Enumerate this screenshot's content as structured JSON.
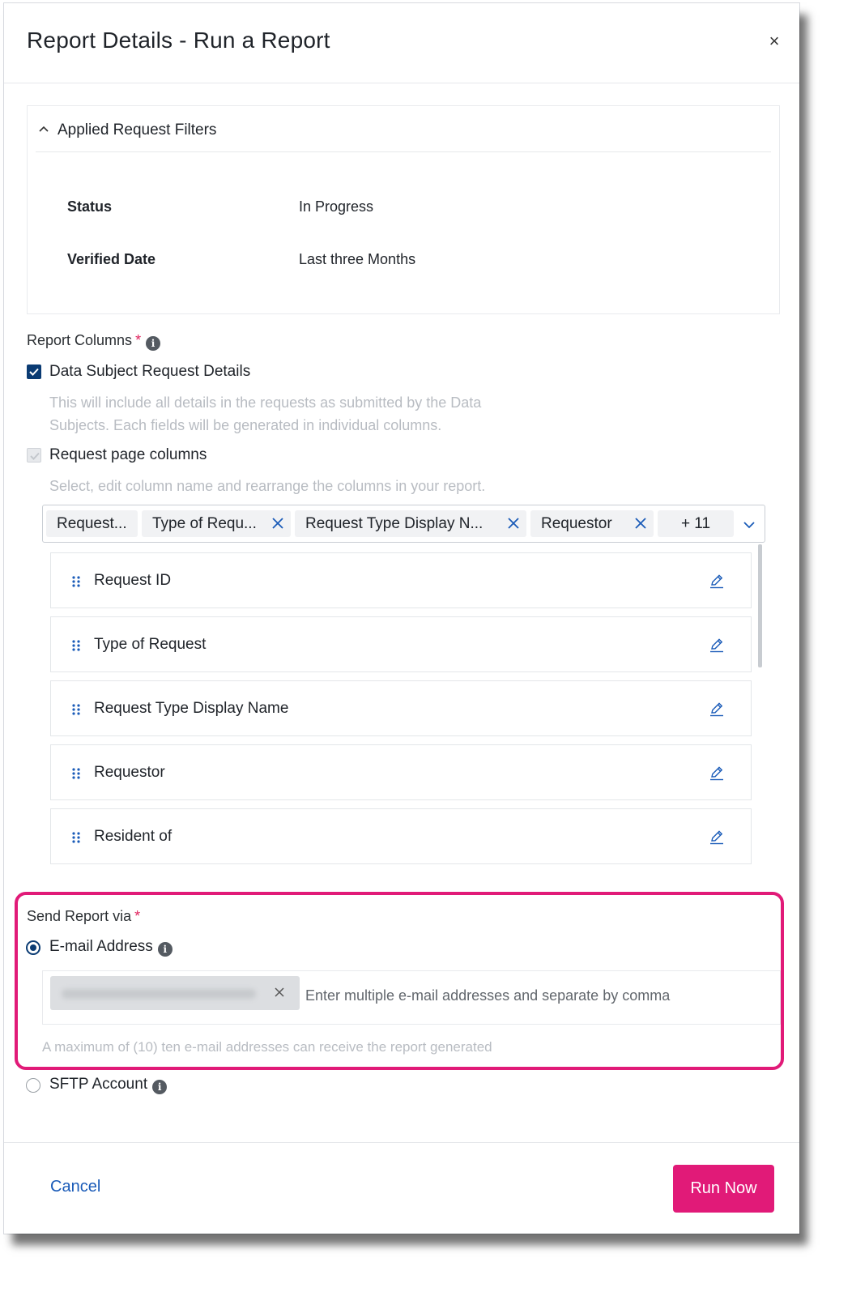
{
  "modal": {
    "title": "Report Details - Run a Report",
    "close_label": "×"
  },
  "filters": {
    "title": "Applied Request Filters",
    "rows": [
      {
        "label": "Status",
        "value": "In Progress"
      },
      {
        "label": "Verified Date",
        "value": "Last three Months"
      }
    ]
  },
  "report_columns": {
    "label": "Report Columns",
    "required_mark": "*",
    "info": "i",
    "dsr_details": {
      "label": "Data Subject Request Details",
      "checked": true,
      "helper_line1": "This will include all details in the requests as submitted by the Data",
      "helper_line2": "Subjects. Each fields will be generated in individual columns."
    },
    "page_columns": {
      "label": "Request page columns",
      "checked": true,
      "disabled": true,
      "helper": "Select, edit column name and rearrange the columns in your report."
    },
    "chips": [
      "Request...",
      "Type of Requ...",
      "Request Type Display N...",
      "Requestor"
    ],
    "more_chip": "+ 11",
    "columns": [
      "Request ID",
      "Type of Request",
      "Request Type Display Name",
      "Requestor",
      "Resident of"
    ]
  },
  "send_via": {
    "label": "Send Report via",
    "required_mark": "*",
    "email_option": "E-mail Address",
    "email_placeholder": "Enter multiple e-mail addresses and separate by comma",
    "email_hint": "A maximum of (10) ten e-mail addresses can receive the report generated",
    "sftp_option": "SFTP Account",
    "info": "i",
    "selected": "email"
  },
  "footer": {
    "cancel_label": "Cancel",
    "run_label": "Run Now"
  },
  "colors": {
    "accent": "#e11a78",
    "link": "#1a5bb8",
    "checkbox": "#0a3b73"
  }
}
